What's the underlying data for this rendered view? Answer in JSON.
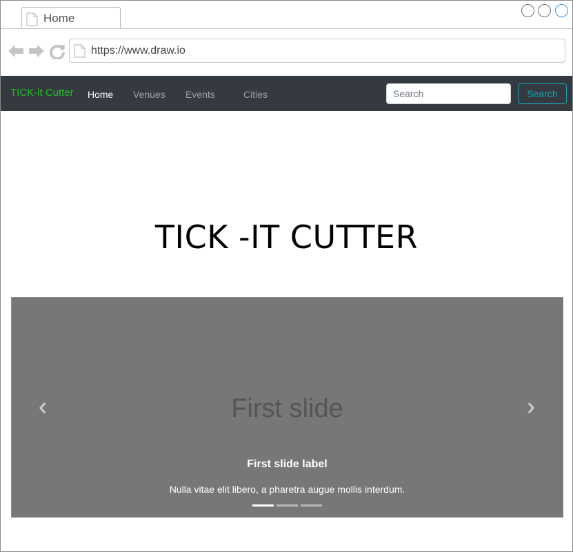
{
  "browser": {
    "tab_title": "Home",
    "url": "https://www.draw.io"
  },
  "navbar": {
    "brand": "TICK-it Cutter",
    "links": [
      {
        "label": "Home",
        "active": true
      },
      {
        "label": "Venues",
        "active": false
      },
      {
        "label": "Events",
        "active": false
      },
      {
        "label": "Cities",
        "active": false
      }
    ],
    "search": {
      "placeholder": "Search",
      "value": ""
    },
    "search_button": "Search"
  },
  "hero": {
    "title": "TICK -IT CUTTER"
  },
  "carousel": {
    "slide_placeholder": "First slide",
    "label": "First slide label",
    "caption": "Nulla vitae elit libero, a pharetra augue mollis interdum.",
    "indicator_count": 3,
    "active_indicator": 1
  },
  "colors": {
    "navbar_bg": "#343a40",
    "brand": "#1ec11e",
    "search_accent": "#17a2b8",
    "carousel_bg": "#777777"
  },
  "icons": [
    "page-icon",
    "back-arrow-icon",
    "forward-arrow-icon",
    "reload-icon",
    "chevron-left-icon",
    "chevron-right-icon"
  ]
}
